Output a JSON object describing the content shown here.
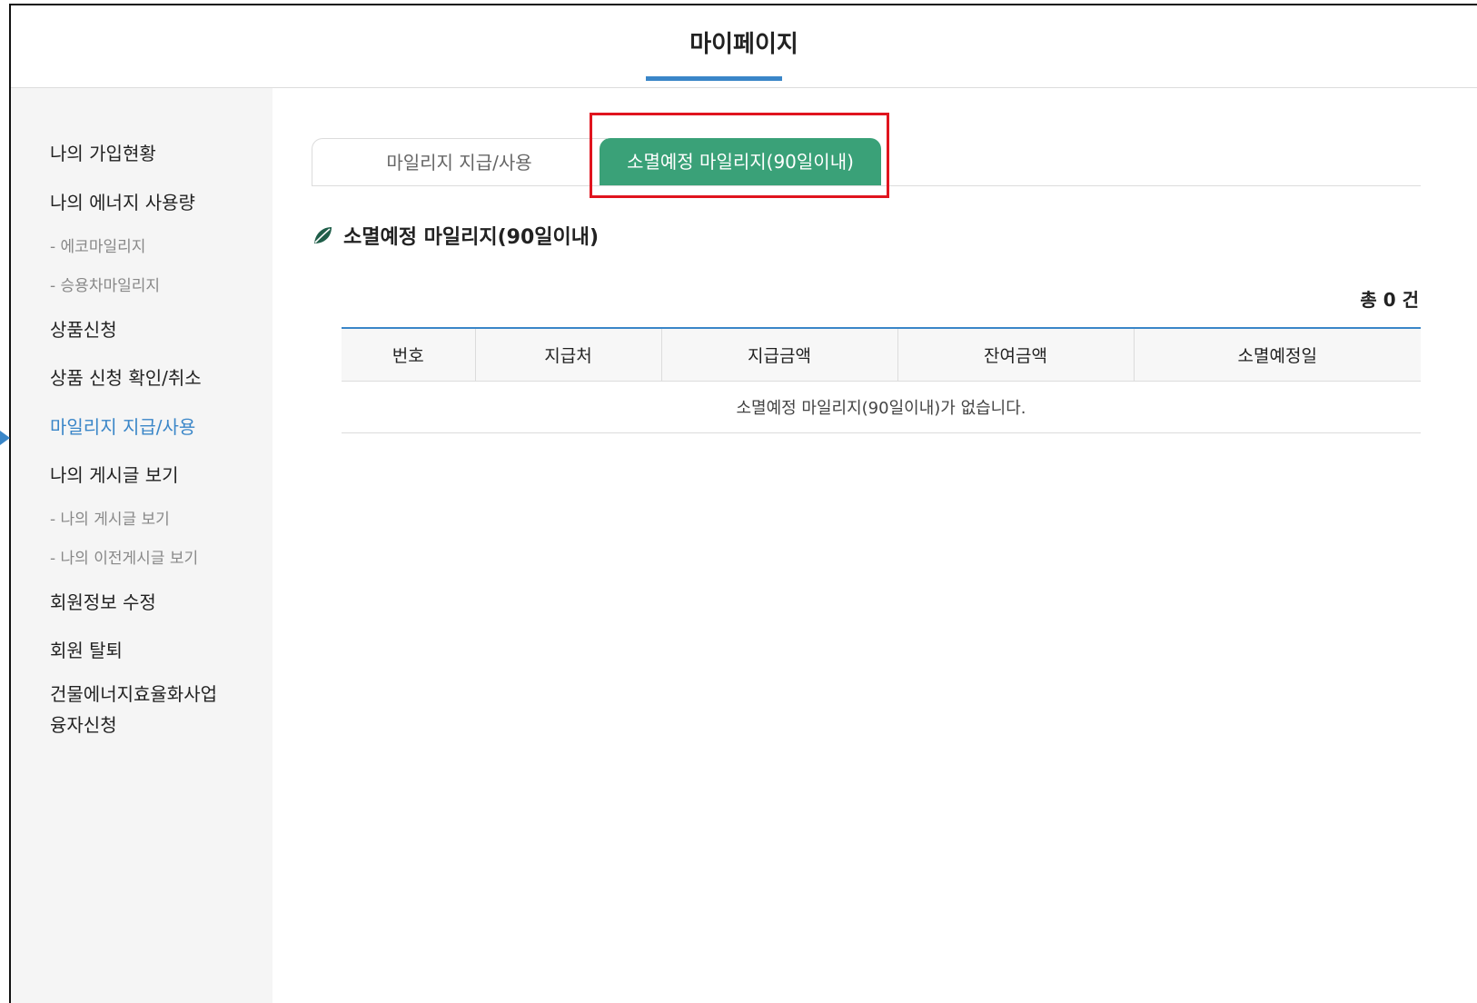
{
  "header": {
    "title": "마이페이지"
  },
  "sidebar": {
    "items": [
      {
        "label": "나의 가입현황"
      },
      {
        "label": "나의 에너지 사용량"
      },
      {
        "label": "- 에코마일리지"
      },
      {
        "label": "- 승용차마일리지"
      },
      {
        "label": "상품신청"
      },
      {
        "label": "상품 신청 확인/취소"
      },
      {
        "label": "마일리지 지급/사용"
      },
      {
        "label": "나의 게시글 보기"
      },
      {
        "label": "- 나의 게시글 보기"
      },
      {
        "label": "- 나의 이전게시글 보기"
      },
      {
        "label": "회원정보 수정"
      },
      {
        "label": "회원 탈퇴"
      },
      {
        "label": "건물에너지효율화사업"
      },
      {
        "label": "융자신청"
      }
    ],
    "active_item": "마일리지 지급/사용"
  },
  "tabs": [
    {
      "label": "마일리지 지급/사용",
      "selected": false
    },
    {
      "label": "소멸예정 마일리지(90일이내)",
      "selected": true
    }
  ],
  "section": {
    "title": "소멸예정 마일리지(90일이내)",
    "icon": "leaf-icon"
  },
  "total": "총 0 건",
  "table": {
    "columns": [
      "번호",
      "지급처",
      "지급금액",
      "잔여금액",
      "소멸예정일"
    ],
    "empty_message": "소멸예정 마일리지(90일이내)가 없습니다."
  },
  "colors": {
    "accent_blue": "#3a86c8",
    "tab_green": "#3aa178",
    "highlight_red": "#e0141e"
  }
}
